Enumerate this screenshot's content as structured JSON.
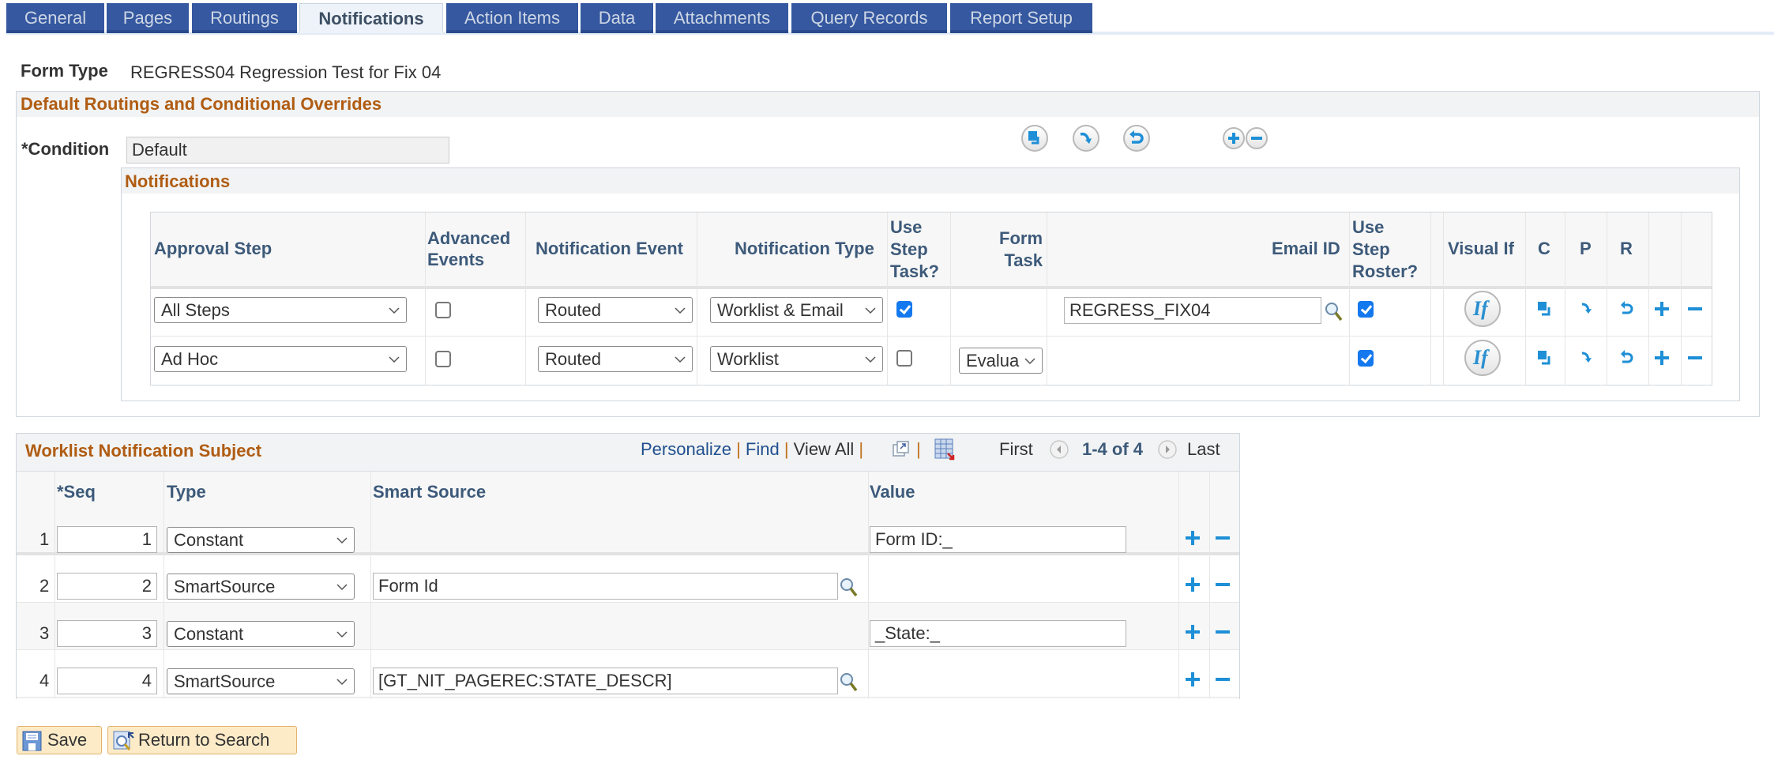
{
  "tabs": [
    {
      "label": "General",
      "active": false
    },
    {
      "label": "Pages",
      "active": false
    },
    {
      "label": "Routings",
      "active": false
    },
    {
      "label": "Notifications",
      "active": true
    },
    {
      "label": "Action Items",
      "active": false
    },
    {
      "label": "Data",
      "active": false
    },
    {
      "label": "Attachments",
      "active": false
    },
    {
      "label": "Query Records",
      "active": false
    },
    {
      "label": "Report Setup",
      "active": false
    }
  ],
  "form_type": {
    "label": "Form Type",
    "value": "REGRESS04 Regression Test for Fix 04"
  },
  "routings": {
    "title": "Default Routings and Conditional Overrides",
    "condition_label": "*Condition",
    "condition_value": "Default",
    "toolbar_icons": [
      "copy-icon",
      "paste-icon",
      "reset-icon",
      "add-icon",
      "delete-icon"
    ]
  },
  "notifications": {
    "title": "Notifications",
    "columns": {
      "approval_step": "Approval Step",
      "advanced_events": [
        "Advanced",
        "Events"
      ],
      "notification_event": "Notification Event",
      "notification_type": "Notification Type",
      "use_step_task": [
        "Use",
        "Step",
        "Task?"
      ],
      "form_task": [
        "Form",
        "Task"
      ],
      "email_id": "Email ID",
      "use_step_roster": [
        "Use",
        "Step",
        "Roster?"
      ],
      "visual_if": "Visual If",
      "c": "C",
      "p": "P",
      "r": "R"
    },
    "rows": [
      {
        "approval_step": "All Steps",
        "advanced_events": false,
        "notification_event": "Routed",
        "notification_type": "Worklist & Email",
        "use_step_task": true,
        "form_task": "",
        "email_id": "REGRESS_FIX04",
        "use_step_roster": true,
        "visual_if": "If"
      },
      {
        "approval_step": "Ad Hoc",
        "advanced_events": false,
        "notification_event": "Routed",
        "notification_type": "Worklist",
        "use_step_task": false,
        "form_task": "Evalua",
        "email_id": "",
        "use_step_roster": true,
        "visual_if": "If"
      }
    ]
  },
  "subject": {
    "title": "Worklist Notification Subject",
    "nav": {
      "personalize": "Personalize",
      "find": "Find",
      "view_all": "View All",
      "first": "First",
      "range": "1-4 of 4",
      "last": "Last"
    },
    "columns": {
      "seq": "*Seq",
      "type": "Type",
      "smart_source": "Smart Source",
      "value": "Value"
    },
    "rows": [
      {
        "num": "1",
        "seq": "1",
        "type": "Constant",
        "smart_source": null,
        "value": "Form ID:_"
      },
      {
        "num": "2",
        "seq": "2",
        "type": "SmartSource",
        "smart_source": "Form Id",
        "value": null
      },
      {
        "num": "3",
        "seq": "3",
        "type": "Constant",
        "smart_source": null,
        "value": "_State:_"
      },
      {
        "num": "4",
        "seq": "4",
        "type": "SmartSource",
        "smart_source": "[GT_NIT_PAGEREC:STATE_DESCR]",
        "value": null
      }
    ]
  },
  "buttons": {
    "save": "Save",
    "return_to_search": "Return to Search"
  },
  "colors": {
    "tab_bg": "#3558a0",
    "section_title": "#b05c12",
    "header_text": "#3d5a7a",
    "checkbox": "#1478ee",
    "action_icon": "#1e8fd6",
    "button_bg": "#fdebc8"
  }
}
